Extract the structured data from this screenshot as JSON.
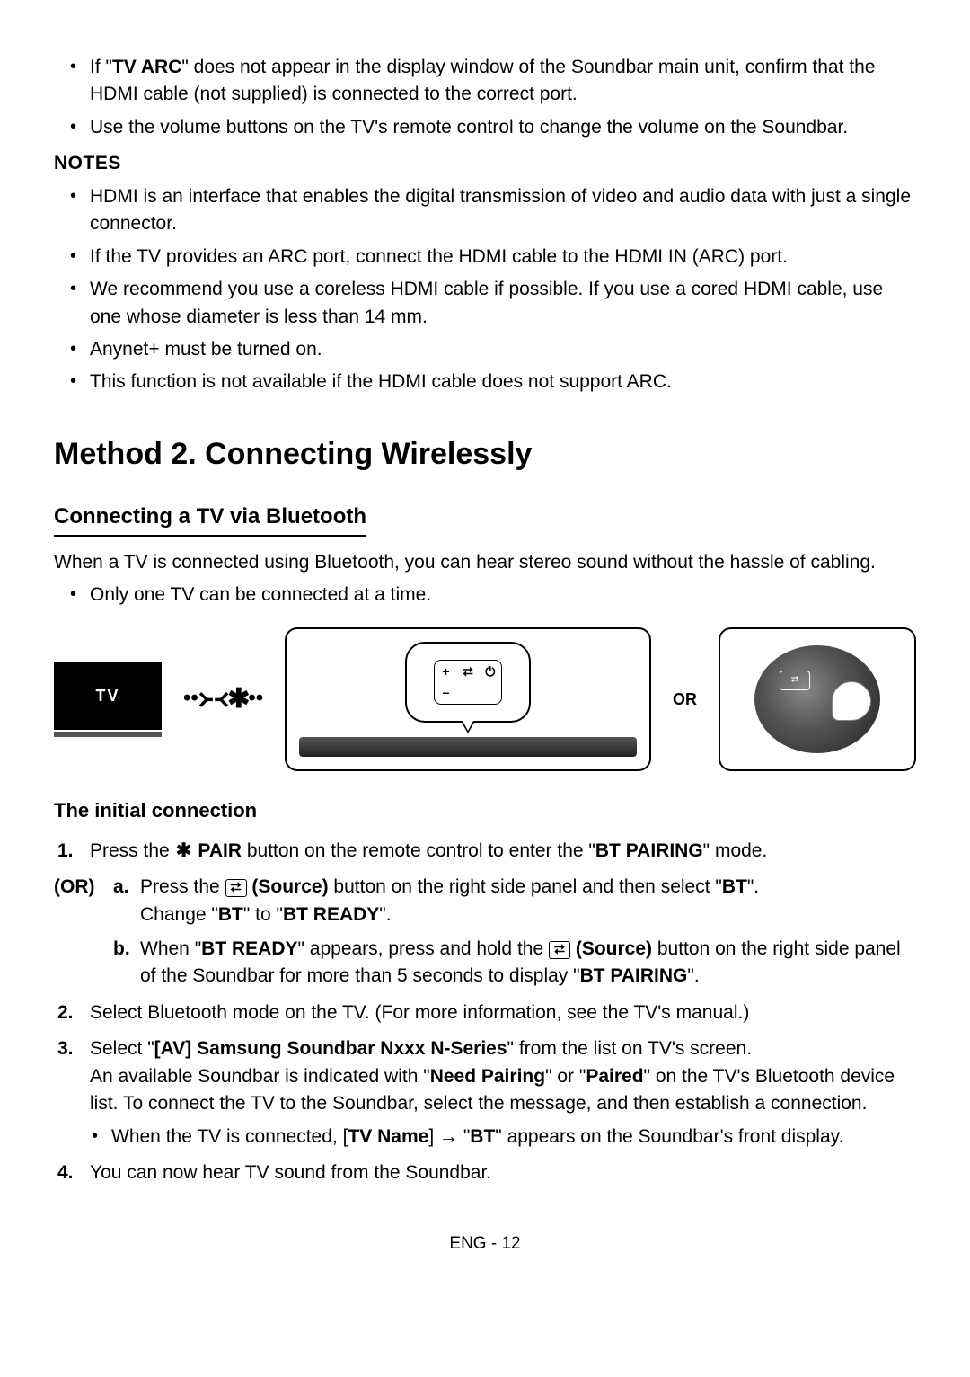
{
  "top_bullets": [
    {
      "pre": "If \"",
      "b": "TV ARC",
      "post": "\" does not appear in the display window of the Soundbar main unit, confirm that the HDMI cable (not supplied) is connected to the correct port."
    },
    {
      "text": "Use the volume buttons on the TV's remote control to change the volume on the Soundbar."
    }
  ],
  "notes_heading": "NOTES",
  "notes": [
    "HDMI is an interface that enables the digital transmission of video and audio data with just a single connector.",
    "If the TV provides an ARC port, connect the HDMI cable to the HDMI IN (ARC) port.",
    "We recommend you use a coreless HDMI cable if possible. If you use a cored HDMI cable, use one whose diameter is less than 14 mm.",
    "Anynet+ must be turned on.",
    "This function is not available if the HDMI cable does not support ARC."
  ],
  "method_heading": "Method 2. Connecting Wirelessly",
  "subhead": "Connecting a TV via Bluetooth",
  "intro": "When a TV is connected using Bluetooth, you can hear stereo sound without the hassle of cabling.",
  "intro_bullet": "Only one TV can be connected at a time.",
  "diagram": {
    "tv_label": "TV",
    "or_label": "OR",
    "remote_keys": {
      "plus": "+",
      "minus": "−",
      "source": "⮂",
      "power": "⏻"
    },
    "disc_btn": "⮂"
  },
  "initial_heading": "The initial connection",
  "step1": {
    "num": "1.",
    "pre": "Press the ",
    "bt_glyph": "✱",
    "b1": " PAIR",
    "mid": " button on the remote control to enter the \"",
    "b2": "BT PAIRING",
    "post": "\" mode."
  },
  "or_label": "(OR)",
  "step_a": {
    "alpha": "a.",
    "pre": "Press the ",
    "src_glyph": "⮂",
    "b1": " (Source)",
    "mid": " button on the right side panel and then select \"",
    "b2": "BT",
    "post": "\".",
    "line2_pre": "Change \"",
    "line2_b1": "BT",
    "line2_mid": "\" to \"",
    "line2_b2": "BT READY",
    "line2_post": "\"."
  },
  "step_b": {
    "alpha": "b.",
    "pre": "When \"",
    "b1": "BT READY",
    "mid": "\" appears, press and hold the ",
    "src_glyph": "⮂",
    "b2": " (Source)",
    "mid2": " button on the right side panel of the Soundbar for more than 5 seconds to display \"",
    "b3": "BT PAIRING",
    "post": "\"."
  },
  "step2": {
    "num": "2.",
    "text": "Select Bluetooth mode on the TV. (For more information, see the TV's manual.)"
  },
  "step3": {
    "num": "3.",
    "pre": "Select \"",
    "b1": "[AV] Samsung Soundbar Nxxx N-Series",
    "mid": "\" from the list on TV's screen.",
    "line2_pre": "An available Soundbar is indicated with \"",
    "line2_b1": "Need Pairing",
    "line2_mid": "\" or \"",
    "line2_b2": "Paired",
    "line2_post": "\" on the TV's Bluetooth device list. To connect the TV to the Soundbar, select the message, and then establish a connection.",
    "sub_pre": "When the TV is connected, [",
    "sub_b1": "TV Name",
    "sub_mid": "] → \"",
    "sub_b2": "BT",
    "sub_post": "\" appears on the Soundbar's front display."
  },
  "step4": {
    "num": "4.",
    "text": "You can now hear TV sound from the Soundbar."
  },
  "footer": "ENG - 12"
}
